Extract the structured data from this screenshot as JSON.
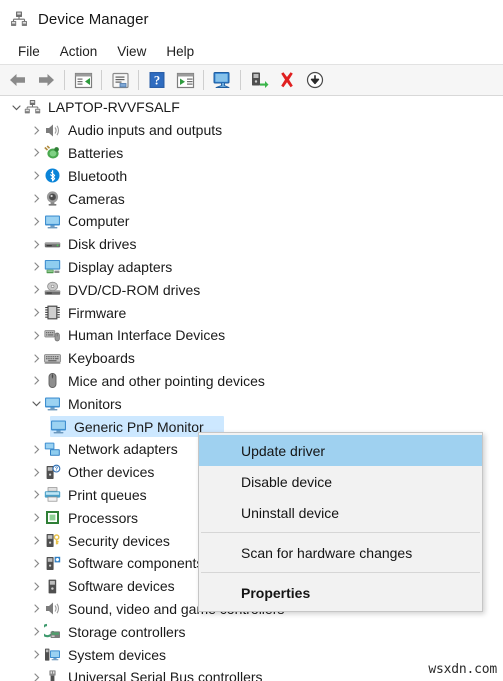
{
  "window": {
    "title": "Device Manager",
    "app_icon": "device-manager-icon"
  },
  "menubar": {
    "items": [
      {
        "label": "File"
      },
      {
        "label": "Action"
      },
      {
        "label": "View"
      },
      {
        "label": "Help"
      }
    ]
  },
  "toolbar": {
    "buttons": [
      {
        "name": "back-arrow-icon",
        "tooltip": "Back"
      },
      {
        "name": "forward-arrow-icon",
        "tooltip": "Forward"
      },
      {
        "name": "separator-1",
        "tooltip": ""
      },
      {
        "name": "show-hide-console-tree-icon",
        "tooltip": "Show/Hide Console Tree"
      },
      {
        "name": "separator-2",
        "tooltip": ""
      },
      {
        "name": "properties-icon",
        "tooltip": "Properties"
      },
      {
        "name": "separator-3",
        "tooltip": ""
      },
      {
        "name": "help-icon",
        "tooltip": "Help"
      },
      {
        "name": "show-hidden-devices-icon",
        "tooltip": "Show hidden devices"
      },
      {
        "name": "separator-4",
        "tooltip": ""
      },
      {
        "name": "scan-for-hardware-changes-icon",
        "tooltip": "Scan for hardware changes"
      },
      {
        "name": "separator-5",
        "tooltip": ""
      },
      {
        "name": "update-driver-icon",
        "tooltip": "Update driver"
      },
      {
        "name": "uninstall-device-icon",
        "tooltip": "Uninstall device"
      },
      {
        "name": "disable-device-icon",
        "tooltip": "Disable device"
      }
    ]
  },
  "tree": {
    "nodes": [
      {
        "label": "LAPTOP-RVVFSALF",
        "depth": 0,
        "state": "expanded",
        "icon": "computer-node-icon",
        "selected": false
      },
      {
        "label": "Audio inputs and outputs",
        "depth": 1,
        "state": "collapsed",
        "icon": "speaker-icon",
        "selected": false
      },
      {
        "label": "Batteries",
        "depth": 1,
        "state": "collapsed",
        "icon": "battery-icon",
        "selected": false
      },
      {
        "label": "Bluetooth",
        "depth": 1,
        "state": "collapsed",
        "icon": "bluetooth-icon",
        "selected": false
      },
      {
        "label": "Cameras",
        "depth": 1,
        "state": "collapsed",
        "icon": "camera-icon",
        "selected": false
      },
      {
        "label": "Computer",
        "depth": 1,
        "state": "collapsed",
        "icon": "monitor-icon",
        "selected": false
      },
      {
        "label": "Disk drives",
        "depth": 1,
        "state": "collapsed",
        "icon": "disk-drive-icon",
        "selected": false
      },
      {
        "label": "Display adapters",
        "depth": 1,
        "state": "collapsed",
        "icon": "display-adapter-icon",
        "selected": false
      },
      {
        "label": "DVD/CD-ROM drives",
        "depth": 1,
        "state": "collapsed",
        "icon": "optical-drive-icon",
        "selected": false
      },
      {
        "label": "Firmware",
        "depth": 1,
        "state": "collapsed",
        "icon": "firmware-chip-icon",
        "selected": false
      },
      {
        "label": "Human Interface Devices",
        "depth": 1,
        "state": "collapsed",
        "icon": "hid-icon",
        "selected": false
      },
      {
        "label": "Keyboards",
        "depth": 1,
        "state": "collapsed",
        "icon": "keyboard-icon",
        "selected": false
      },
      {
        "label": "Mice and other pointing devices",
        "depth": 1,
        "state": "collapsed",
        "icon": "mouse-icon",
        "selected": false
      },
      {
        "label": "Monitors",
        "depth": 1,
        "state": "expanded",
        "icon": "monitor-icon",
        "selected": false
      },
      {
        "label": "Generic PnP Monitor",
        "depth": 2,
        "state": "leaf",
        "icon": "monitor-icon",
        "selected": true
      },
      {
        "label": "Network adapters",
        "depth": 1,
        "state": "collapsed",
        "icon": "network-adapter-icon",
        "selected": false
      },
      {
        "label": "Other devices",
        "depth": 1,
        "state": "collapsed",
        "icon": "unknown-device-icon",
        "selected": false
      },
      {
        "label": "Print queues",
        "depth": 1,
        "state": "collapsed",
        "icon": "printer-icon",
        "selected": false
      },
      {
        "label": "Processors",
        "depth": 1,
        "state": "collapsed",
        "icon": "processor-icon",
        "selected": false
      },
      {
        "label": "Security devices",
        "depth": 1,
        "state": "collapsed",
        "icon": "security-device-icon",
        "selected": false
      },
      {
        "label": "Software components",
        "depth": 1,
        "state": "collapsed",
        "icon": "software-component-icon",
        "selected": false
      },
      {
        "label": "Software devices",
        "depth": 1,
        "state": "collapsed",
        "icon": "software-device-icon",
        "selected": false
      },
      {
        "label": "Sound, video and game controllers",
        "depth": 1,
        "state": "collapsed",
        "icon": "speaker-icon",
        "selected": false
      },
      {
        "label": "Storage controllers",
        "depth": 1,
        "state": "collapsed",
        "icon": "storage-controller-icon",
        "selected": false
      },
      {
        "label": "System devices",
        "depth": 1,
        "state": "collapsed",
        "icon": "system-device-icon",
        "selected": false
      },
      {
        "label": "Universal Serial Bus controllers",
        "depth": 1,
        "state": "collapsed",
        "icon": "usb-icon",
        "selected": false
      }
    ]
  },
  "context_menu": {
    "items": [
      {
        "label": "Update driver",
        "highlighted": true,
        "bold": false,
        "separator_after": false
      },
      {
        "label": "Disable device",
        "highlighted": false,
        "bold": false,
        "separator_after": false
      },
      {
        "label": "Uninstall device",
        "highlighted": false,
        "bold": false,
        "separator_after": true
      },
      {
        "label": "Scan for hardware changes",
        "highlighted": false,
        "bold": false,
        "separator_after": true
      },
      {
        "label": "Properties",
        "highlighted": false,
        "bold": true,
        "separator_after": false
      }
    ]
  },
  "watermark": {
    "text": "wsxdn.com"
  },
  "colors": {
    "selection_blue": "#cde8ff",
    "menu_highlight_blue": "#9fd1f0",
    "toolbar_bg": "#f6f6f6",
    "menu_bg": "#f2f2f2",
    "text": "#1a1a1a"
  }
}
